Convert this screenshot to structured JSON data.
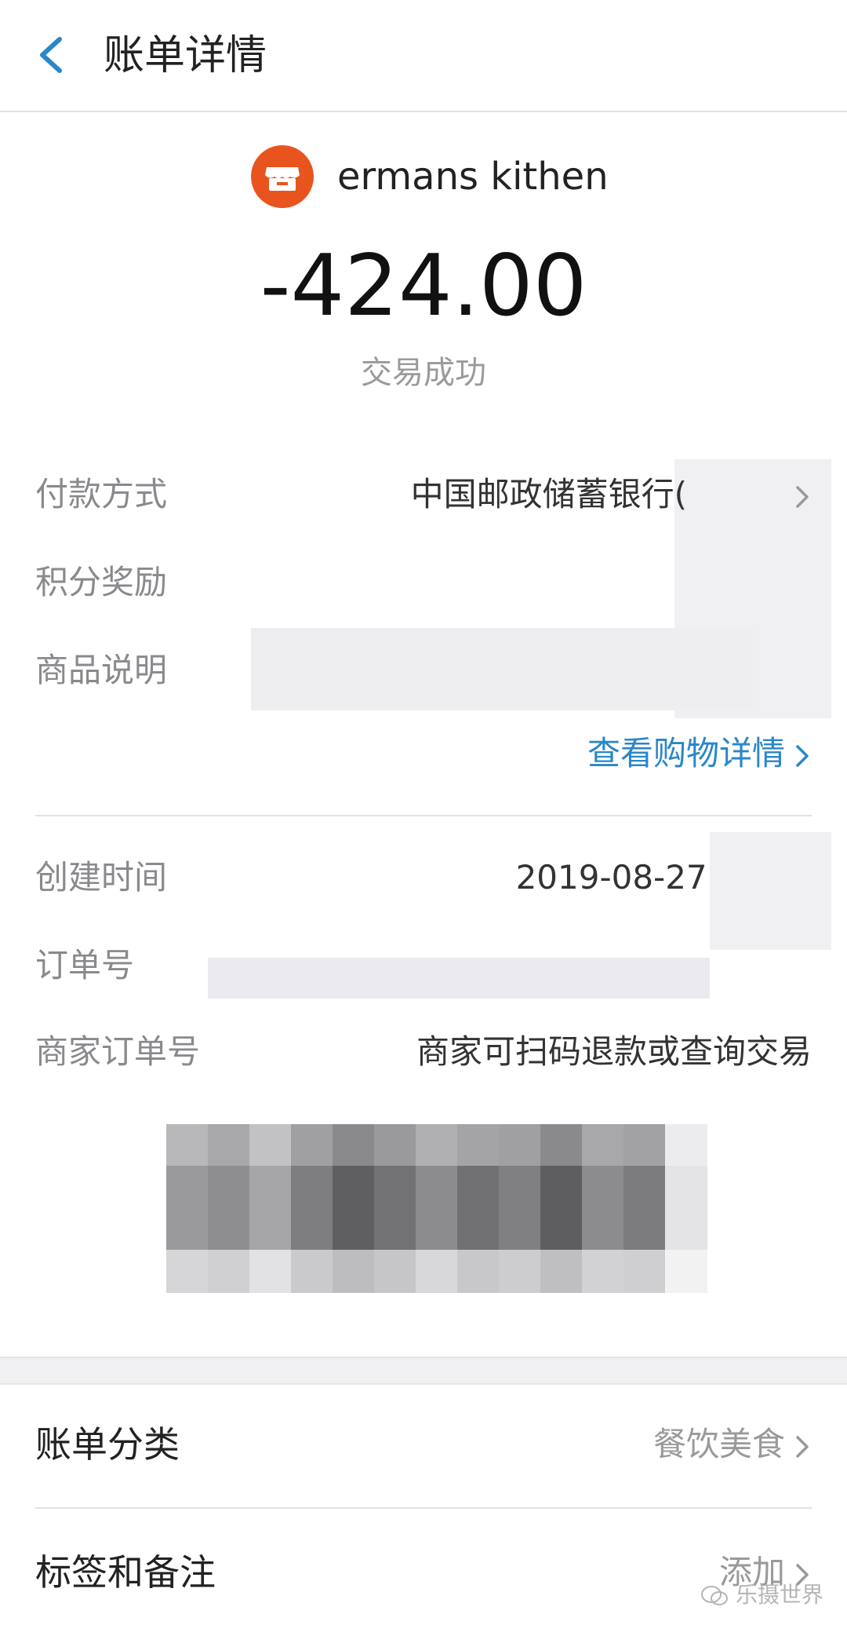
{
  "header": {
    "title": "账单详情",
    "back_icon": "chevron-left-icon"
  },
  "merchant": {
    "name": "ermans kithen",
    "icon": "store-icon",
    "icon_color": "#e8541e"
  },
  "transaction": {
    "amount": "-424.00",
    "status": "交易成功"
  },
  "details": {
    "payment_method": {
      "label": "付款方式",
      "value": "中国邮政储蓄银行("
    },
    "points": {
      "label": "积分奖励",
      "value": ""
    },
    "product_desc": {
      "label": "商品说明",
      "value": ""
    },
    "shopping_link": "查看购物详情"
  },
  "order_info": {
    "created_time": {
      "label": "创建时间",
      "value": "2019-08-27 "
    },
    "order_no": {
      "label": "订单号",
      "value": ""
    },
    "merchant_order_no": {
      "label": "商家订单号",
      "value": "商家可扫码退款或查询交易"
    }
  },
  "bill_category": {
    "label": "账单分类",
    "value": "餐饮美食"
  },
  "tags_notes": {
    "label": "标签和备注",
    "value": "添加"
  },
  "watermark": "乐摄世界",
  "colors": {
    "link": "#2a87c8",
    "accent": "#2a87c8",
    "muted": "#9a9a9a"
  }
}
